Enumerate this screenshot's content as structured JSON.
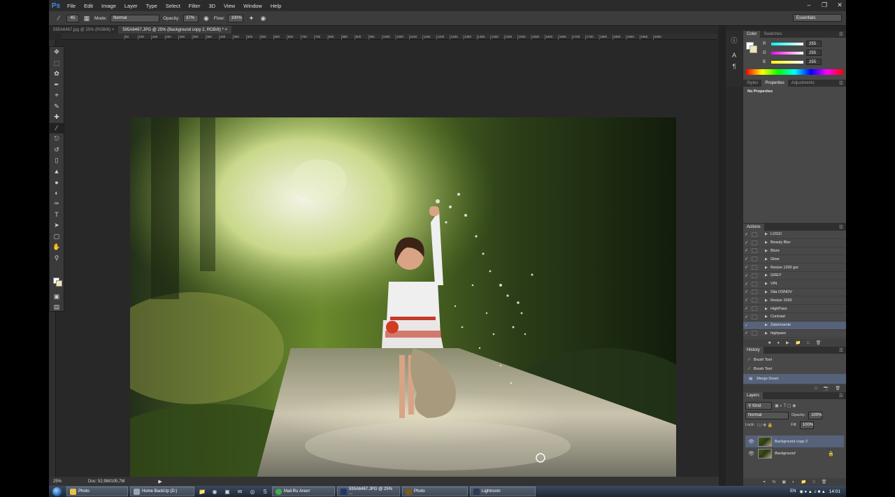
{
  "menubar": {
    "logo": "Ps",
    "items": [
      "File",
      "Edit",
      "Image",
      "Layer",
      "Type",
      "Select",
      "Filter",
      "3D",
      "View",
      "Window",
      "Help"
    ],
    "window_controls": [
      "minimize-icon",
      "restore-icon",
      "close-icon"
    ]
  },
  "options": {
    "brush_size": "45",
    "mode_label": "Mode:",
    "mode_value": "Normal",
    "opacity_label": "Opacity:",
    "opacity_value": "37%",
    "flow_label": "Flow:",
    "flow_value": "100%",
    "workspace": "Essentials"
  },
  "doc_tabs": [
    {
      "label": "595A6467.jpg @ 25% (RGB/8)",
      "active": false
    },
    {
      "label": "595A6467.JPG @ 25% (Background copy 2, RGB/8) *",
      "active": true
    }
  ],
  "ruler_ticks": [
    "50",
    "100",
    "150",
    "200",
    "250",
    "300",
    "350",
    "400",
    "450",
    "500",
    "550",
    "600",
    "650",
    "700",
    "750",
    "800",
    "850",
    "900",
    "950",
    "1000",
    "1050",
    "1100",
    "1150",
    "1200",
    "1250",
    "1300",
    "1350",
    "1400",
    "1450",
    "1500",
    "1550",
    "1600",
    "1650",
    "1700",
    "1750",
    "1800",
    "1850",
    "1900",
    "1950",
    "2000"
  ],
  "tools": [
    "move-tool-icon",
    "marquee-tool-icon",
    "lasso-tool-icon",
    "quick-select-tool-icon",
    "crop-tool-icon",
    "eyedropper-tool-icon",
    "healing-brush-tool-icon",
    "brush-tool-icon",
    "clone-stamp-tool-icon",
    "history-brush-tool-icon",
    "eraser-tool-icon",
    "paint-bucket-tool-icon",
    "blur-tool-icon",
    "dodge-tool-icon",
    "pen-tool-icon",
    "type-tool-icon",
    "path-select-tool-icon",
    "rectangle-tool-icon",
    "hand-tool-icon",
    "zoom-tool-icon"
  ],
  "status": {
    "zoom": "25%",
    "doc": "Doc: 52,9M/105,7M"
  },
  "color_panel": {
    "tabs": [
      "Color",
      "Swatches"
    ],
    "r_label": "R",
    "r_value": "255",
    "g_label": "G",
    "g_value": "255",
    "b_label": "B",
    "b_value": "255"
  },
  "properties_panel": {
    "tabs": [
      "Styles",
      "Properties",
      "Adjustments"
    ],
    "message": "No Properties"
  },
  "actions_panel": {
    "title": "Actions",
    "items": [
      "LOGO",
      "Beauty Blur",
      "Blure",
      "Glow",
      "Resize 1200 gor",
      "GREY",
      "VIN",
      "Sita OSNOV",
      "Resize 1500",
      "HighPass",
      "Contrast",
      "Zatemnenie",
      "highpass"
    ],
    "selected": "Zatemnenie"
  },
  "history_panel": {
    "title": "History",
    "items": [
      "Brush Tool",
      "Brush Tool",
      "Merge Down"
    ],
    "selected": "Merge Down"
  },
  "layers_panel": {
    "title": "Layers",
    "kind_label": "Kind",
    "blend_mode": "Normal",
    "opacity_label": "Opacity:",
    "opacity_value": "100%",
    "lock_label": "Lock:",
    "fill_label": "Fill:",
    "fill_value": "100%",
    "layers": [
      "Background copy 2",
      "Background"
    ],
    "selected": "Background copy 2"
  },
  "taskbar": {
    "items": [
      "Photo",
      "Home BackUp (D:)",
      "Mail.Ru Агент",
      "595A6467.JPG @ 25% ...",
      "Photo",
      "Lightroom"
    ],
    "language": "EN",
    "clock": "14:01"
  },
  "colors": {
    "accent_selected": "#56627a",
    "panel_bg": "#484848",
    "canvas_bg": "#282828",
    "ps_blue": "#3a8ee6"
  }
}
